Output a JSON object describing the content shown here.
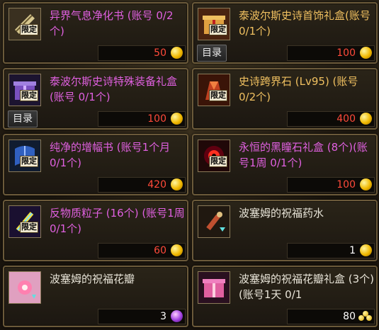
{
  "items": [
    {
      "title": "异界气息净化书 (账号 0/2个)",
      "price": "50",
      "tag": "限定",
      "currency": "coin",
      "color": "purple",
      "icon": "scroll-icon",
      "menu": ""
    },
    {
      "title": "泰波尔斯史诗首饰礼盒(账号 0/1个)",
      "price": "100",
      "tag": "限定",
      "currency": "coin",
      "color": "gold",
      "icon": "gift-box-icon",
      "menu": "目录"
    },
    {
      "title": "泰波尔斯史诗特殊装备礼盒(账号 0/1个)",
      "price": "100",
      "tag": "限定",
      "currency": "coin",
      "color": "purple",
      "icon": "purple-box-icon",
      "menu": "目录"
    },
    {
      "title": "史诗跨界石 (Lv95) (账号 0/2个)",
      "price": "400",
      "tag": "限定",
      "currency": "coin",
      "color": "gold",
      "icon": "red-stone-icon",
      "menu": ""
    },
    {
      "title": "纯净的增幅书 (账号1个月 0/1个)",
      "price": "420",
      "tag": "限定",
      "currency": "coin",
      "color": "purple",
      "icon": "blue-book-icon",
      "menu": ""
    },
    {
      "title": "永恒的黑瞳石礼盒 (8个)(账号1周 0/1个)",
      "price": "100",
      "tag": "限定",
      "currency": "coin",
      "color": "purple",
      "icon": "dark-orb-icon",
      "menu": ""
    },
    {
      "title": "反物质粒子 (16个) (账号1周 0/1个)",
      "price": "60",
      "tag": "限定",
      "currency": "coin",
      "color": "purple",
      "icon": "crystal-icon",
      "menu": ""
    },
    {
      "title": "波塞姆的祝福药水",
      "price": "1",
      "tag": "",
      "currency": "coin",
      "color": "white",
      "icon": "potion-icon",
      "menu": ""
    },
    {
      "title": "波塞姆的祝福花瓣",
      "price": "3",
      "tag": "",
      "currency": "orb",
      "color": "white",
      "icon": "petal-icon",
      "menu": ""
    },
    {
      "title": "波塞姆的祝福花瓣礼盒 (3个)(账号1天 0/1",
      "price": "80",
      "tag": "",
      "currency": "coins",
      "color": "white",
      "icon": "pink-gift-icon",
      "menu": ""
    }
  ]
}
